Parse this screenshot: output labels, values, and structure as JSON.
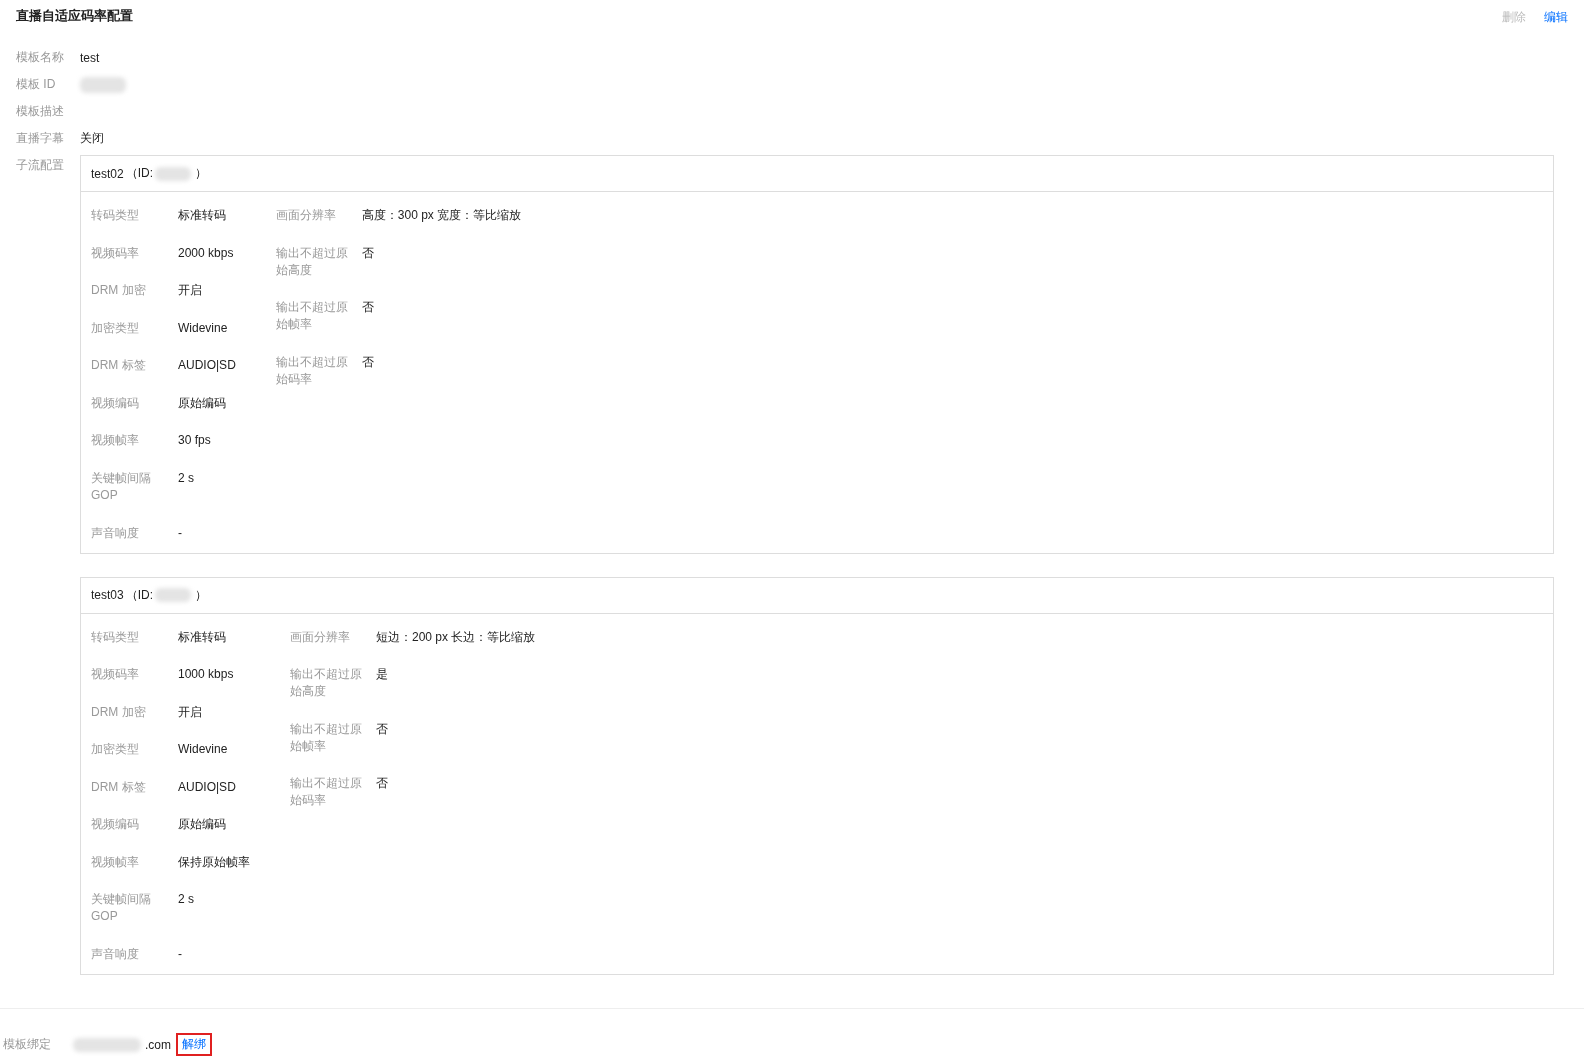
{
  "title": "直播自适应码率配置",
  "actions": [
    {
      "label": "删除",
      "disabled": true
    },
    {
      "label": "编辑",
      "disabled": false
    }
  ],
  "fields": [
    {
      "label": "模板名称",
      "value": "test",
      "kind": "text"
    },
    {
      "label": "模板 ID",
      "kind": "redacted"
    },
    {
      "label": "模板描述",
      "kind": "text"
    },
    {
      "label": "直播字幕",
      "value": "关闭",
      "kind": "text"
    }
  ],
  "streams_label": "子流配置",
  "streams": [
    {
      "name": "test02",
      "id_label": "（ID:",
      "id_close": "）",
      "left": [
        {
          "label": "转码类型",
          "value": "标准转码"
        },
        {
          "label": "视频码率",
          "value": "2000 kbps"
        },
        {
          "label": "DRM 加密",
          "value": "开启"
        },
        {
          "label": "加密类型",
          "value": "Widevine"
        },
        {
          "label": "DRM 标签",
          "value": "AUDIO|SD"
        },
        {
          "label": "视频编码",
          "value": "原始编码"
        },
        {
          "label": "视频帧率",
          "value": "30 fps"
        },
        {
          "label": "关键帧间隔 GOP",
          "value": "2 s"
        },
        {
          "label": "声音响度",
          "value": "-"
        }
      ],
      "right": [
        {
          "label": "画面分辨率",
          "value": "高度：300 px 宽度：等比缩放"
        },
        {
          "label": "输出不超过原始高度",
          "value": "否"
        },
        {
          "label": "输出不超过原始帧率",
          "value": "否"
        },
        {
          "label": "输出不超过原始码率",
          "value": "否"
        }
      ]
    },
    {
      "name": "test03",
      "id_label": "（ID:",
      "id_close": "）",
      "left": [
        {
          "label": "转码类型",
          "value": "标准转码"
        },
        {
          "label": "视频码率",
          "value": "1000 kbps"
        },
        {
          "label": "DRM 加密",
          "value": "开启"
        },
        {
          "label": "加密类型",
          "value": "Widevine"
        },
        {
          "label": "DRM 标签",
          "value": "AUDIO|SD"
        },
        {
          "label": "视频编码",
          "value": "原始编码"
        },
        {
          "label": "视频帧率",
          "value": "保持原始帧率"
        },
        {
          "label": "关键帧间隔 GOP",
          "value": "2 s"
        },
        {
          "label": "声音响度",
          "value": "-"
        }
      ],
      "right": [
        {
          "label": "画面分辨率",
          "value": "短边：200 px 长边：等比缩放"
        },
        {
          "label": "输出不超过原始高度",
          "value": "是"
        },
        {
          "label": "输出不超过原始帧率",
          "value": "否"
        },
        {
          "label": "输出不超过原始码率",
          "value": "否"
        }
      ]
    }
  ],
  "binding": {
    "label": "模板绑定",
    "domain_suffix": ".com",
    "unbind": {
      "label": "解绑",
      "highlighted": true
    }
  }
}
